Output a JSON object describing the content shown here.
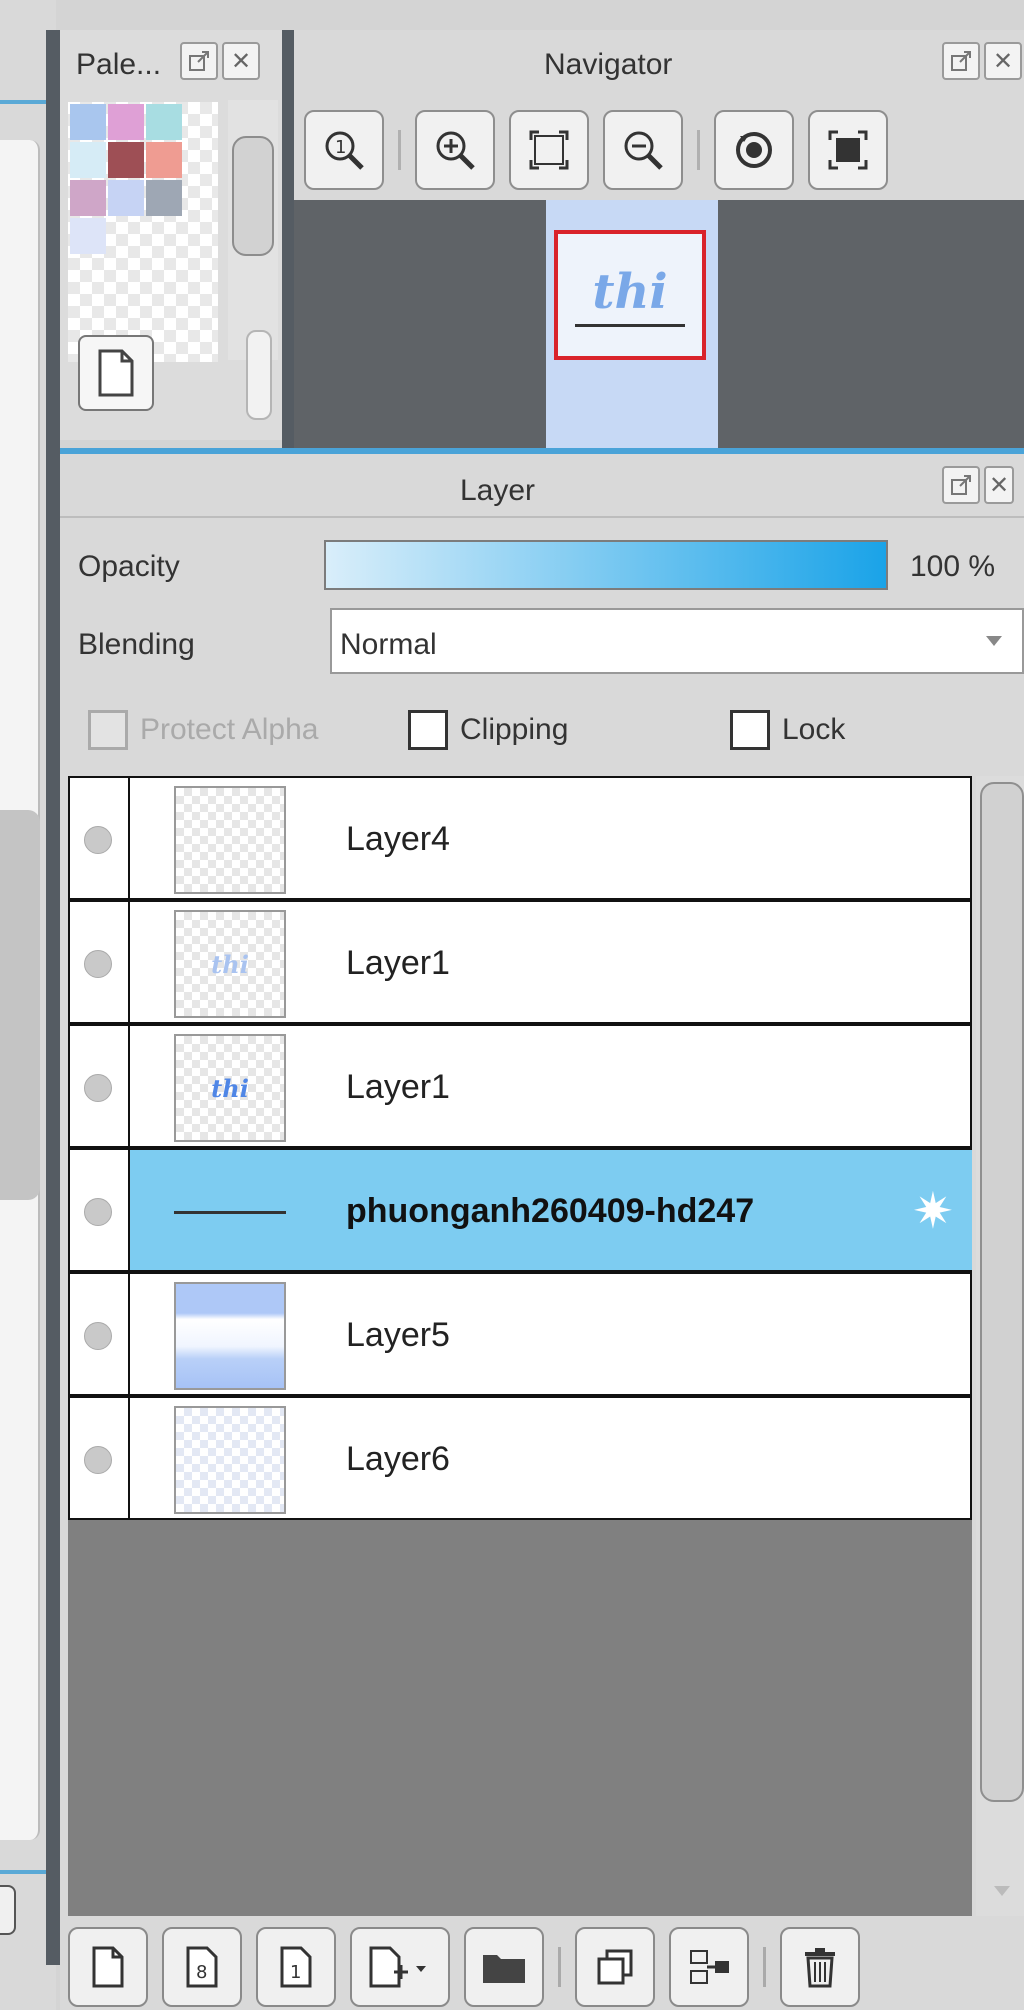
{
  "palette": {
    "title": "Pale..."
  },
  "navigator": {
    "title": "Navigator",
    "thumbnail_text": "thi"
  },
  "layer_panel": {
    "title": "Layer",
    "opacity_label": "Opacity",
    "opacity_value": "100 %",
    "opacity_fraction": 1.0,
    "blending_label": "Blending",
    "blending_value": "Normal",
    "protect_alpha_label": "Protect Alpha",
    "clipping_label": "Clipping",
    "lock_label": "Lock",
    "layers": [
      {
        "name": "Layer4",
        "selected": false
      },
      {
        "name": "Layer1",
        "selected": false
      },
      {
        "name": "Layer1",
        "selected": false
      },
      {
        "name": "phuonganh260409-hd247",
        "selected": true
      },
      {
        "name": "Layer5",
        "selected": false
      },
      {
        "name": "Layer6",
        "selected": false
      }
    ]
  },
  "colors": {
    "accent_blue": "#4aa3d8",
    "selected_row": "#7dccf1",
    "nav_frame": "#d9232b"
  },
  "icons": [
    "popout-icon",
    "close-icon",
    "new-palette-icon",
    "zoom-100-icon",
    "zoom-in-icon",
    "fit-icon",
    "zoom-out-icon",
    "rotate-reset-icon",
    "fullscreen-icon",
    "gear-icon",
    "new-layer-icon",
    "new-8bit-layer-icon",
    "new-1bit-layer-icon",
    "new-layer-menu-icon",
    "folder-icon",
    "duplicate-icon",
    "merge-icon",
    "trash-icon"
  ]
}
